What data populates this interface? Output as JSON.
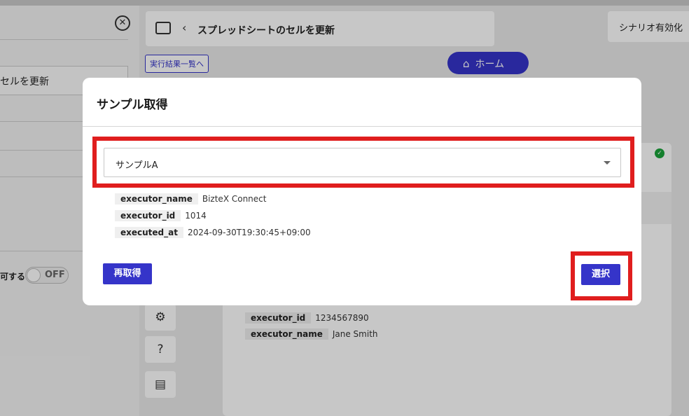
{
  "background": {
    "left_panel": {
      "field_value": "セルを更新",
      "toggle_label": "可する",
      "toggle_state": "OFF"
    },
    "header": {
      "title": "スプレッドシートのセルを更新",
      "scenario_button": "シナリオ有効化"
    },
    "results_link": "実行結果一覧へ",
    "home_button": "ホーム",
    "meta": [
      {
        "key": "executor_id",
        "value": "1234567890"
      },
      {
        "key": "executor_name",
        "value": "Jane Smith"
      }
    ]
  },
  "modal": {
    "title": "サンプル取得",
    "select_value": "サンプルA",
    "meta": [
      {
        "key": "executor_name",
        "value": "BizteX Connect"
      },
      {
        "key": "executor_id",
        "value": "1014"
      },
      {
        "key": "executed_at",
        "value": "2024-09-30T19:30:45+09:00"
      }
    ],
    "refetch_button": "再取得",
    "select_button": "選択"
  },
  "colors": {
    "primary": "#3534c9",
    "highlight": "#e01e1e",
    "success": "#1aa33a"
  },
  "icons": [
    "close-icon",
    "folder-icon",
    "chevron-left-icon",
    "home-icon",
    "check-icon",
    "gear-icon",
    "help-icon",
    "document-icon",
    "chevron-down-icon"
  ]
}
